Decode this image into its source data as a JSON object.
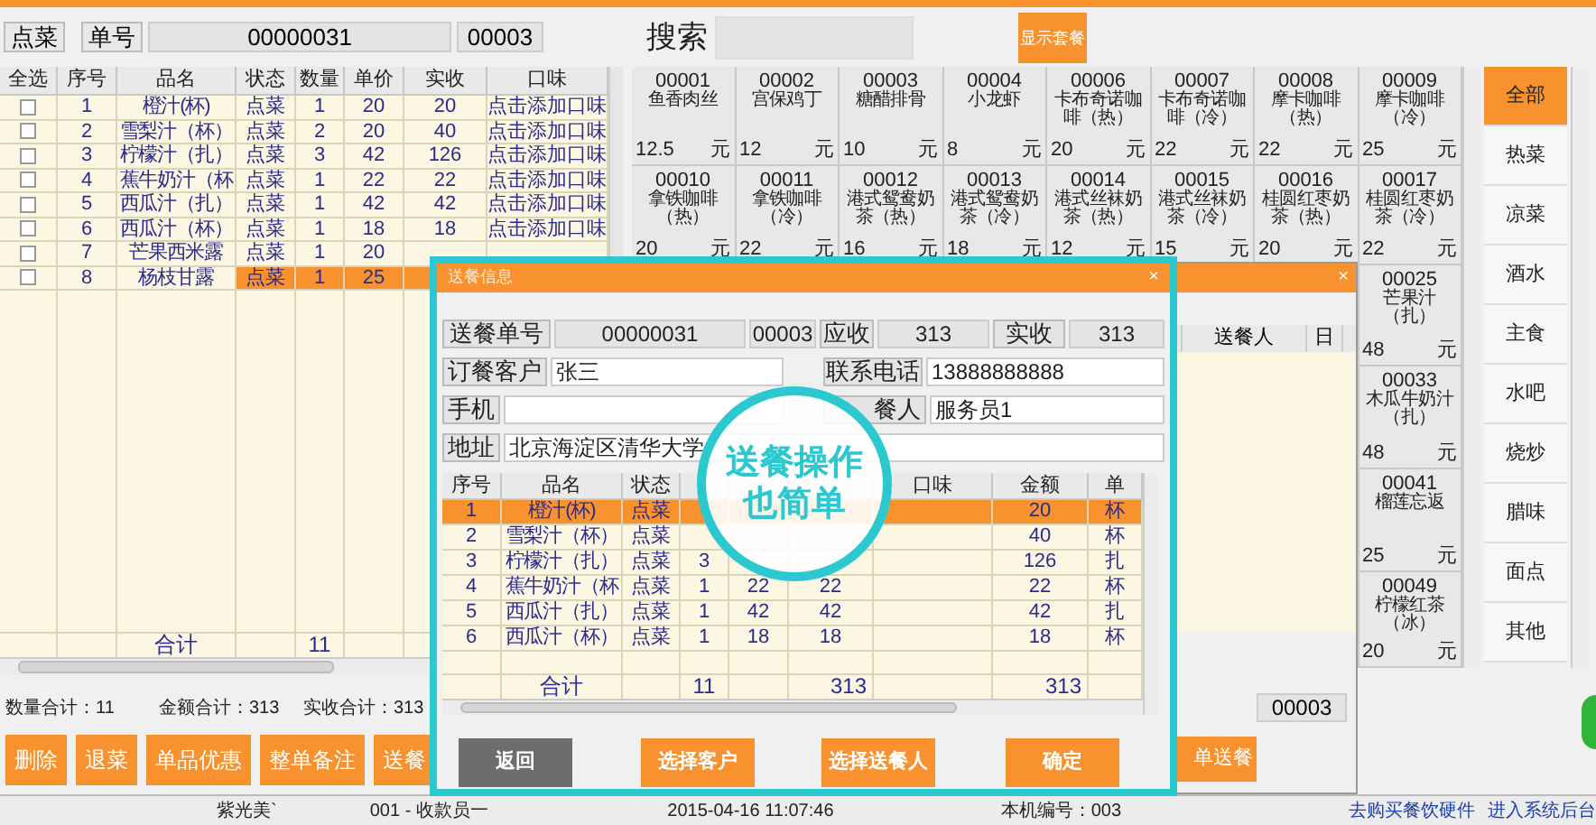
{
  "order_bar": {
    "button": "点菜",
    "label": "单号",
    "order_no": "00000031",
    "table_no": "00003"
  },
  "order_table": {
    "columns": [
      "全选",
      "序号",
      "品名",
      "状态",
      "数量",
      "单价",
      "实收",
      "口味"
    ],
    "rows": [
      {
        "checked": false,
        "selected": false,
        "no": "1",
        "name": "橙汁(杯)",
        "status": "点菜",
        "qty": "1",
        "price": "20",
        "paid": "20",
        "flavor": "点击添加口味"
      },
      {
        "checked": false,
        "selected": false,
        "no": "2",
        "name": "雪梨汁（杯）",
        "status": "点菜",
        "qty": "2",
        "price": "20",
        "paid": "40",
        "flavor": "点击添加口味"
      },
      {
        "checked": false,
        "selected": false,
        "no": "3",
        "name": "柠檬汁（扎）",
        "status": "点菜",
        "qty": "3",
        "price": "42",
        "paid": "126",
        "flavor": "点击添加口味"
      },
      {
        "checked": false,
        "selected": false,
        "no": "4",
        "name": "蕉牛奶汁（杯",
        "status": "点菜",
        "qty": "1",
        "price": "22",
        "paid": "22",
        "flavor": "点击添加口味"
      },
      {
        "checked": false,
        "selected": false,
        "no": "5",
        "name": "西瓜汁（扎）",
        "status": "点菜",
        "qty": "1",
        "price": "42",
        "paid": "42",
        "flavor": "点击添加口味"
      },
      {
        "checked": false,
        "selected": false,
        "no": "6",
        "name": "西瓜汁（杯）",
        "status": "点菜",
        "qty": "1",
        "price": "18",
        "paid": "18",
        "flavor": "点击添加口味"
      },
      {
        "checked": false,
        "selected": false,
        "no": "7",
        "name": "芒果西米露",
        "status": "点菜",
        "qty": "1",
        "price": "20"
      },
      {
        "checked": false,
        "selected": true,
        "no": "8",
        "name": "杨枝甘露",
        "status": "点菜",
        "qty": "1",
        "price": "25"
      }
    ],
    "total": {
      "label": "合计",
      "qty": "11"
    }
  },
  "summary": [
    "数量合计：11",
    "金额合计：313",
    "实收合计：313"
  ],
  "actions": [
    "删除",
    "退菜",
    "单品优惠",
    "整单备注",
    "送餐"
  ],
  "search": {
    "label": "搜索",
    "button": "显示套餐"
  },
  "dish_rows": [
    {
      "dishes": [
        {
          "code": "00001",
          "name": "鱼香肉丝",
          "price": "12.5",
          "unit": "元"
        },
        {
          "code": "00002",
          "name": "宫保鸡丁",
          "price": "12",
          "unit": "元"
        },
        {
          "code": "00003",
          "name": "糖醋排骨",
          "price": "10",
          "unit": "元"
        },
        {
          "code": "00004",
          "name": "小龙虾",
          "price": "8",
          "unit": "元"
        },
        {
          "code": "00006",
          "name": "卡布奇诺咖啡（热）",
          "price": "20",
          "unit": "元"
        },
        {
          "code": "00007",
          "name": "卡布奇诺咖啡（冷）",
          "price": "22",
          "unit": "元"
        },
        {
          "code": "00008",
          "name": "摩卡咖啡（热）",
          "price": "22",
          "unit": "元"
        },
        {
          "code": "00009",
          "name": "摩卡咖啡（冷）",
          "price": "25",
          "unit": "元"
        }
      ]
    },
    {
      "dishes": [
        {
          "code": "00010",
          "name": "拿铁咖啡（热）",
          "price": "20",
          "unit": "元"
        },
        {
          "code": "00011",
          "name": "拿铁咖啡（冷）",
          "price": "22",
          "unit": "元"
        },
        {
          "code": "00012",
          "name": "港式鸳鸯奶茶（热）",
          "price": "16",
          "unit": "元"
        },
        {
          "code": "00013",
          "name": "港式鸳鸯奶茶（冷）",
          "price": "18",
          "unit": "元"
        },
        {
          "code": "00014",
          "name": "港式丝袜奶茶（热）",
          "price": "12",
          "unit": "元"
        },
        {
          "code": "00015",
          "name": "港式丝袜奶茶（冷）",
          "price": "15",
          "unit": "元"
        },
        {
          "code": "00016",
          "name": "桂圆红枣奶茶（热）",
          "price": "20",
          "unit": "元"
        },
        {
          "code": "00017",
          "name": "桂圆红枣奶茶（冷）",
          "price": "22",
          "unit": "元"
        }
      ]
    },
    {
      "dishes": [
        {
          "code": "00025",
          "name": "芒果汁（扎）",
          "price": "48",
          "unit": "元"
        }
      ]
    },
    {
      "dishes": [
        {
          "code": "00033",
          "name": "木瓜牛奶汁（扎）",
          "price": "48",
          "unit": "元"
        }
      ]
    },
    {
      "dishes": [
        {
          "code": "00041",
          "name": "榴莲忘返",
          "price": "25",
          "unit": "元"
        }
      ]
    },
    {
      "dishes": [
        {
          "code": "00049",
          "name": "柠檬红茶（冰）",
          "price": "20",
          "unit": "元"
        }
      ]
    }
  ],
  "categories": [
    {
      "label": "全部",
      "selected": true
    },
    {
      "label": "热菜",
      "selected": false
    },
    {
      "label": "凉菜",
      "selected": false
    },
    {
      "label": "酒水",
      "selected": false
    },
    {
      "label": "主食",
      "selected": false
    },
    {
      "label": "水吧",
      "selected": false
    },
    {
      "label": "烧炒",
      "selected": false
    },
    {
      "label": "腊味",
      "selected": false
    },
    {
      "label": "面点",
      "selected": false
    },
    {
      "label": "其他",
      "selected": false
    }
  ],
  "back_window": {
    "close": "×",
    "columns": [
      "送餐人",
      "日"
    ],
    "field": "00003",
    "button": "单送餐"
  },
  "dialog": {
    "title": "送餐信息",
    "close": "×",
    "order_label": "送餐单号",
    "order_no": "00000031",
    "table_no": "00003",
    "due_label": "应收",
    "due": "313",
    "paid_label": "实收",
    "paid": "313",
    "customer_label": "订餐客户",
    "customer": "张三",
    "phone_label": "联系电话",
    "phone": "13888888888",
    "mobile_label": "手机",
    "courier_label": "餐人",
    "courier": "服务员1",
    "address_label": "地址",
    "address": "北京海淀区清华大学",
    "table": {
      "columns": {
        "no": "序号",
        "name": "品名",
        "status": "状态",
        "flavor": "口味",
        "amount": "金额",
        "unit": "单"
      },
      "rows": [
        {
          "selected": true,
          "no": "1",
          "name": "橙汁(杯)",
          "status": "点菜",
          "amount": "20",
          "unit": "杯"
        },
        {
          "selected": false,
          "no": "2",
          "name": "雪梨汁（杯）",
          "status": "点菜",
          "amount": "40",
          "unit": "杯"
        },
        {
          "selected": false,
          "no": "3",
          "name": "柠檬汁（扎）",
          "status": "点菜",
          "qty": "3",
          "amount": "126",
          "unit": "扎"
        },
        {
          "selected": false,
          "no": "4",
          "name": "蕉牛奶汁（杯",
          "status": "点菜",
          "qty": "1",
          "price": "22",
          "paid": "22",
          "amount": "22",
          "unit": "杯"
        },
        {
          "selected": false,
          "no": "5",
          "name": "西瓜汁（扎）",
          "status": "点菜",
          "qty": "1",
          "price": "42",
          "paid": "42",
          "amount": "42",
          "unit": "扎"
        },
        {
          "selected": false,
          "no": "6",
          "name": "西瓜汁（杯）",
          "status": "点菜",
          "qty": "1",
          "price": "18",
          "paid": "18",
          "amount": "18",
          "unit": "杯"
        }
      ],
      "total": {
        "name": "合计",
        "qty": "11",
        "paid": "313",
        "amount": "313"
      }
    },
    "buttons": [
      {
        "label": "返回",
        "kind": "secondary"
      },
      {
        "label": "选择客户",
        "kind": "primary"
      },
      {
        "label": "选择送餐人",
        "kind": "primary"
      },
      {
        "label": "确定",
        "kind": "primary"
      }
    ]
  },
  "promo": {
    "text": "送餐操作也简单"
  },
  "status_bar": {
    "items": [
      "紫光美`",
      "001 - 收款员一",
      "2015-04-16 11:07:46",
      "本机编号：003"
    ],
    "links": [
      "去购买餐饮硬件",
      "进入系统后台"
    ]
  }
}
